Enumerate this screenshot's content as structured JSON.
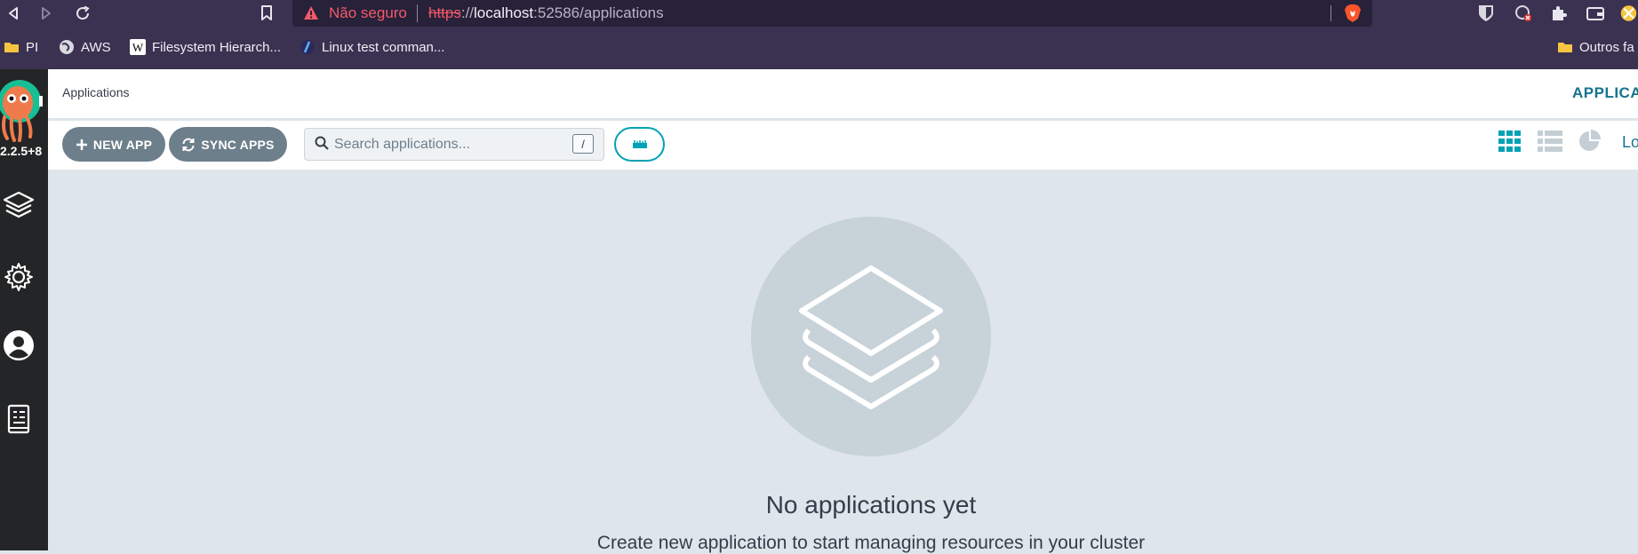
{
  "browser": {
    "security_warning": "Não seguro",
    "url_scheme": "https",
    "url_separator": "://",
    "url_host": "localhost",
    "url_rest": ":52586/applications",
    "bookmarks": [
      {
        "label": "PI",
        "icon": "folder-icon"
      },
      {
        "label": "AWS",
        "icon": "globe-icon"
      },
      {
        "label": "Filesystem Hierarch...",
        "icon": "wikipedia-icon"
      },
      {
        "label": "Linux test comman...",
        "icon": "circle-logo-icon"
      }
    ],
    "other_bookmarks": "Outros fa"
  },
  "sidebar": {
    "version": "2.2.5+8",
    "items": [
      {
        "name": "applications",
        "icon": "layers-icon"
      },
      {
        "name": "settings",
        "icon": "gear-icon"
      },
      {
        "name": "user-info",
        "icon": "user-icon"
      },
      {
        "name": "documentation",
        "icon": "docs-icon"
      }
    ]
  },
  "header": {
    "title": "Applications",
    "right_label": "APPLICATIONS"
  },
  "toolbar": {
    "new_app_label": "NEW APP",
    "sync_apps_label": "SYNC APPS",
    "search_placeholder": "Search applications...",
    "search_shortcut": "/",
    "view_clipped_text": "Log"
  },
  "empty_state": {
    "title": "No applications yet",
    "subtitle": "Create new application to start managing resources in your cluster"
  },
  "colors": {
    "accent": "#00a2b3",
    "button_gray": "#6d7f8b",
    "sidebar_bg": "#242526",
    "chrome_bg": "#3b3252"
  }
}
